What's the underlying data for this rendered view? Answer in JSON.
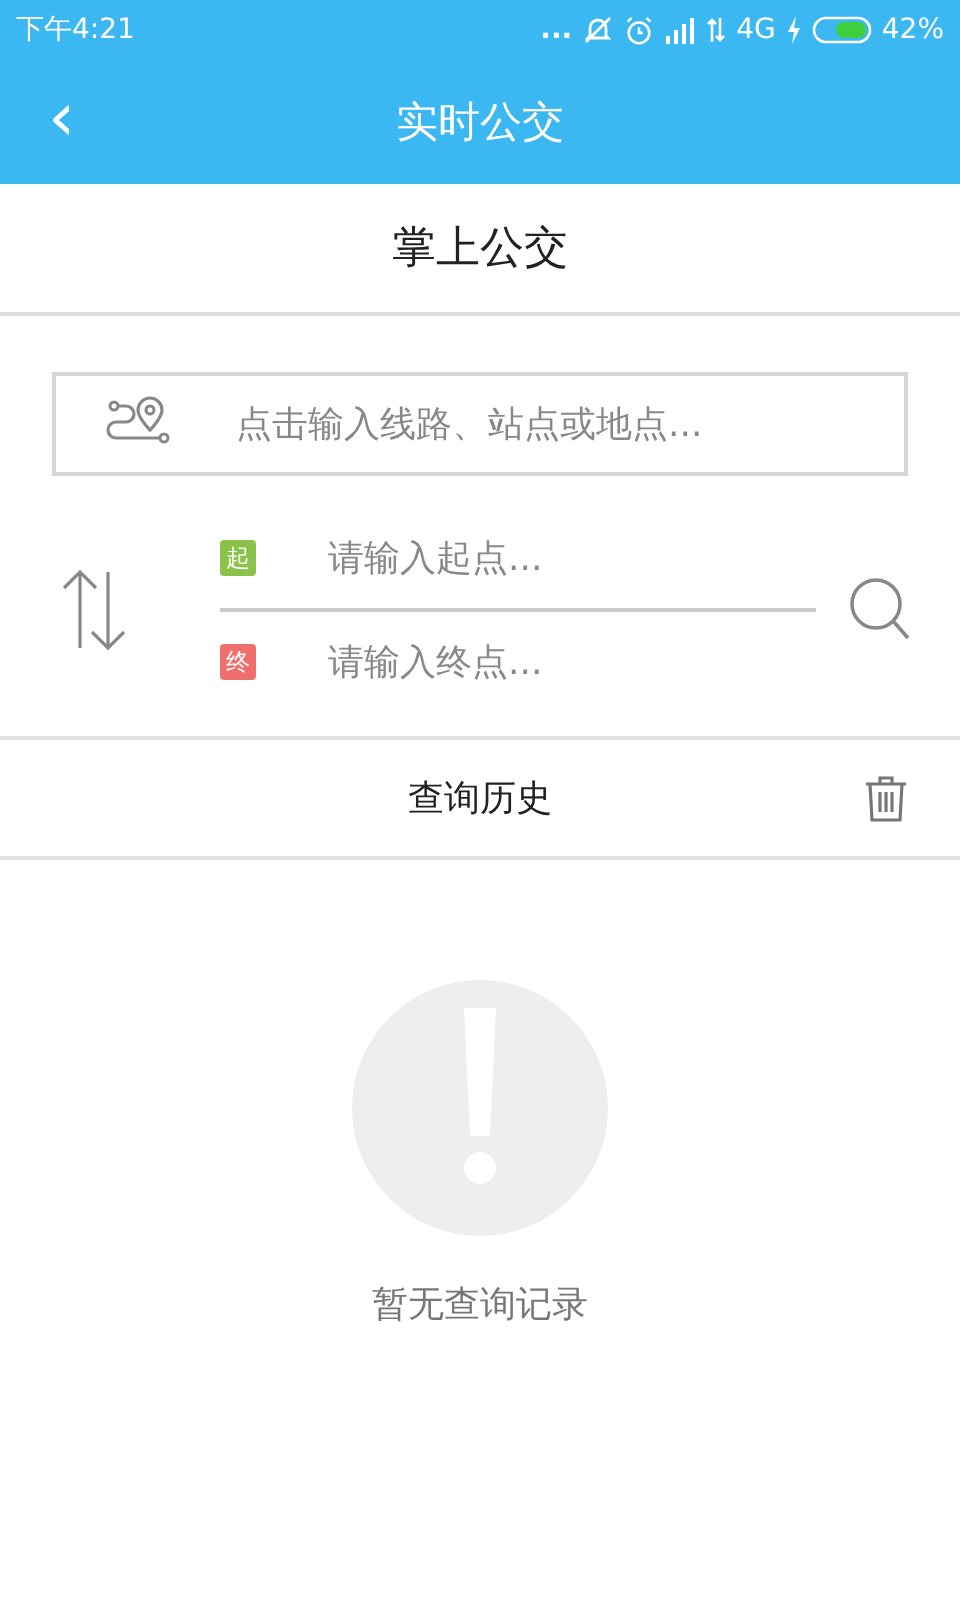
{
  "status_bar": {
    "time": "下午4:21",
    "dots": "...",
    "network": "4G",
    "battery": "42%"
  },
  "header": {
    "back": "‹",
    "title": "实时公交"
  },
  "subheader": {
    "title": "掌上公交"
  },
  "search": {
    "placeholder": "点击输入线路、站点或地点..."
  },
  "route": {
    "fields": [
      {
        "tag": "起",
        "color": "#8bc34a",
        "placeholder": "请输入起点..."
      },
      {
        "tag": "终",
        "color": "#ef6f6c",
        "placeholder": "请输入终点..."
      }
    ]
  },
  "history": {
    "title": "查询历史"
  },
  "empty": {
    "message": "暂无查询记录"
  }
}
